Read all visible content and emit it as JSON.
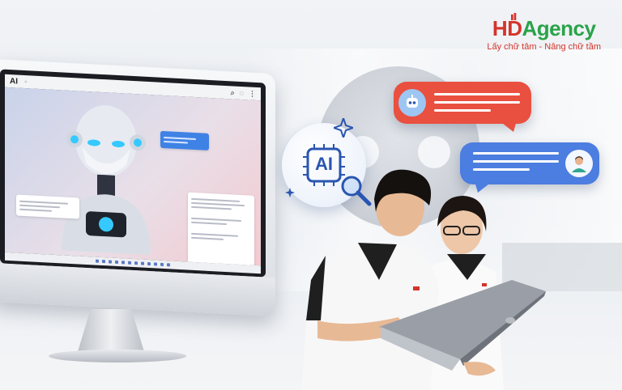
{
  "brand": {
    "logo_hd": "HD",
    "logo_agency": "Agency",
    "tagline": "Lấy chữ tâm - Nâng chữ tầm",
    "colors": {
      "red": "#d4342b",
      "green": "#2aa34a"
    }
  },
  "monitor": {
    "browser_logo": "AI",
    "icons": [
      "search-icon",
      "settings-icon",
      "more-icon"
    ]
  },
  "badge": {
    "label": "AI"
  },
  "chat_bubbles": {
    "red_color": "#e9503f",
    "blue_color": "#4c7de0",
    "red_avatar": "robot-avatar-icon",
    "blue_avatar": "person-avatar-icon"
  }
}
